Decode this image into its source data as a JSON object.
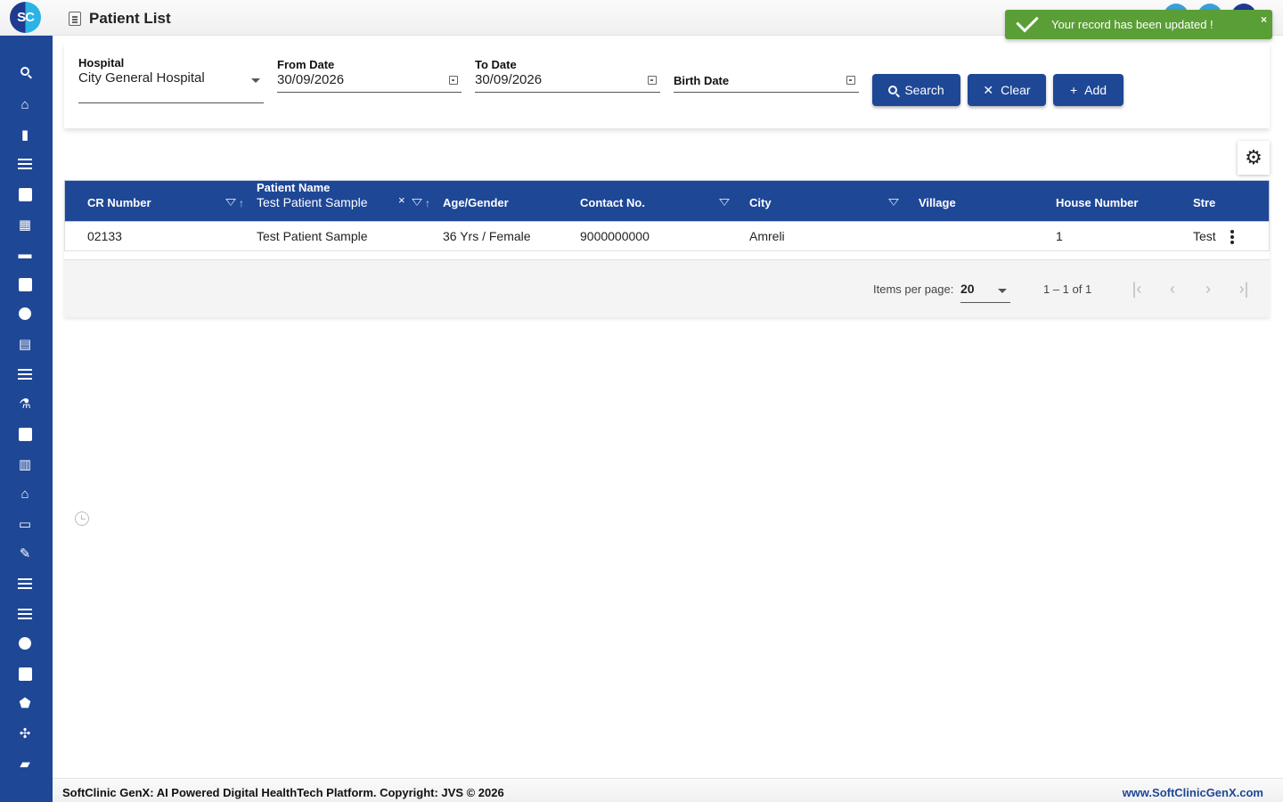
{
  "header": {
    "logo_text": "SC",
    "title": "Patient List"
  },
  "toast": {
    "message": "Your record has been updated !",
    "close": "×",
    "color": "#5a9e36"
  },
  "sidebar": {
    "accent": "#1e4796",
    "items": [
      {
        "icon": "search-icon",
        "glyph": "⌕"
      },
      {
        "icon": "home-icon",
        "glyph": "⌂"
      },
      {
        "icon": "bar-chart-icon",
        "glyph": "▮"
      },
      {
        "icon": "menu-icon",
        "glyph": "≡"
      },
      {
        "icon": "medical-bag-icon",
        "glyph": "✚"
      },
      {
        "icon": "calendar-icon",
        "glyph": "▦"
      },
      {
        "icon": "bed-icon",
        "glyph": "▬"
      },
      {
        "icon": "add-box-icon",
        "glyph": "✚"
      },
      {
        "icon": "person-icon",
        "glyph": "●"
      },
      {
        "icon": "receipt-icon",
        "glyph": "▤"
      },
      {
        "icon": "menu-icon",
        "glyph": "≡"
      },
      {
        "icon": "lab-icon",
        "glyph": "⚗"
      },
      {
        "icon": "medicine-icon",
        "glyph": "✚"
      },
      {
        "icon": "book-icon",
        "glyph": "▥"
      },
      {
        "icon": "warehouse-icon",
        "glyph": "⌂"
      },
      {
        "icon": "devices-icon",
        "glyph": "▭"
      },
      {
        "icon": "wrench-icon",
        "glyph": "✎"
      },
      {
        "icon": "menu-icon",
        "glyph": "≡"
      },
      {
        "icon": "menu-icon",
        "glyph": "≡"
      },
      {
        "icon": "blood-drop-icon",
        "glyph": "●"
      },
      {
        "icon": "library-add-icon",
        "glyph": "✚"
      },
      {
        "icon": "shield-icon",
        "glyph": "⬟"
      },
      {
        "icon": "network-icon",
        "glyph": "✣"
      },
      {
        "icon": "folder-icon",
        "glyph": "▰"
      }
    ]
  },
  "filters": {
    "hospital": {
      "label": "Hospital",
      "value": "City General Hospital"
    },
    "from_date": {
      "label": "From Date",
      "value": "30/09/2026"
    },
    "to_date": {
      "label": "To Date",
      "value": "30/09/2026"
    },
    "birth_date": {
      "label": "Birth Date",
      "value": ""
    },
    "search_label": "Search",
    "clear_label": "Clear",
    "add_label": "Add"
  },
  "table": {
    "columns": [
      {
        "label": "CR Number"
      },
      {
        "label": "Patient Name",
        "filter_value": "Test Patient Sample"
      },
      {
        "label": "Age/Gender"
      },
      {
        "label": "Contact No."
      },
      {
        "label": "City"
      },
      {
        "label": "Village"
      },
      {
        "label": "House Number"
      },
      {
        "label": "Stre"
      }
    ],
    "rows": [
      {
        "cr_number": "02133",
        "patient_name": "Test Patient Sample",
        "age_gender": "36 Yrs / Female",
        "contact": "9000000000",
        "city": "Amreli",
        "village": "",
        "house_number": "1",
        "street": "Test"
      }
    ]
  },
  "paginator": {
    "items_per_page_label": "Items per page:",
    "items_per_page": "20",
    "range": "1 – 1 of 1"
  },
  "footer": {
    "copyright": "SoftClinic GenX: AI Powered Digital HealthTech Platform. Copyright: JVS © 2026",
    "website": "www.SoftClinicGenX.com"
  }
}
